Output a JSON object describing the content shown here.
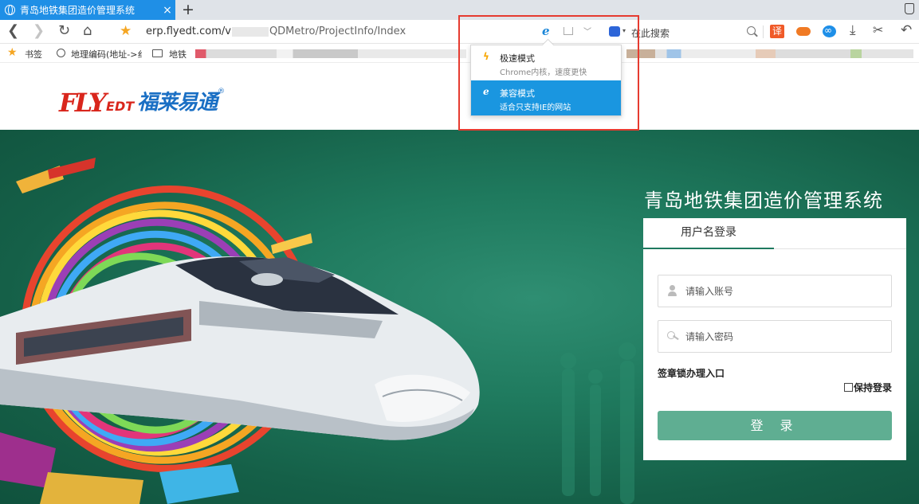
{
  "browser": {
    "tab_title": "青岛地铁集团造价管理系统",
    "tab_close": "×",
    "new_tab": "+",
    "url_host": "erp.flyedt.com/v",
    "url_path": "QDMetro/ProjectInfo/Index",
    "search_placeholder": "在此搜索",
    "ext_translate": "译"
  },
  "bookmarks": {
    "label": "书签",
    "items": [
      "地理编码(地址->纟",
      "地铁"
    ]
  },
  "mode_popup": {
    "fast_title": "极速模式",
    "fast_desc": "Chrome内核，速度更快",
    "compat_title": "兼容模式",
    "compat_desc": "适合只支持IE的网站"
  },
  "logo": {
    "mark": "FLY",
    "edt": "EDT",
    "cn": "福莱易通",
    "reg": "®"
  },
  "page": {
    "system_title": "青岛地铁集团造价管理系统"
  },
  "login": {
    "tab_label": "用户名登录",
    "account_placeholder": "请输入账号",
    "password_placeholder": "请输入密码",
    "sign_entry": "签章锁办理入口",
    "remember_label": "保持登录",
    "submit_label": "登 录"
  },
  "colors": {
    "tab_active": "#1f8fe6",
    "hero_green": "#1f7a5e",
    "login_button": "#5fae92",
    "popup_selected": "#1a96e0",
    "highlight": "#e63b30"
  }
}
